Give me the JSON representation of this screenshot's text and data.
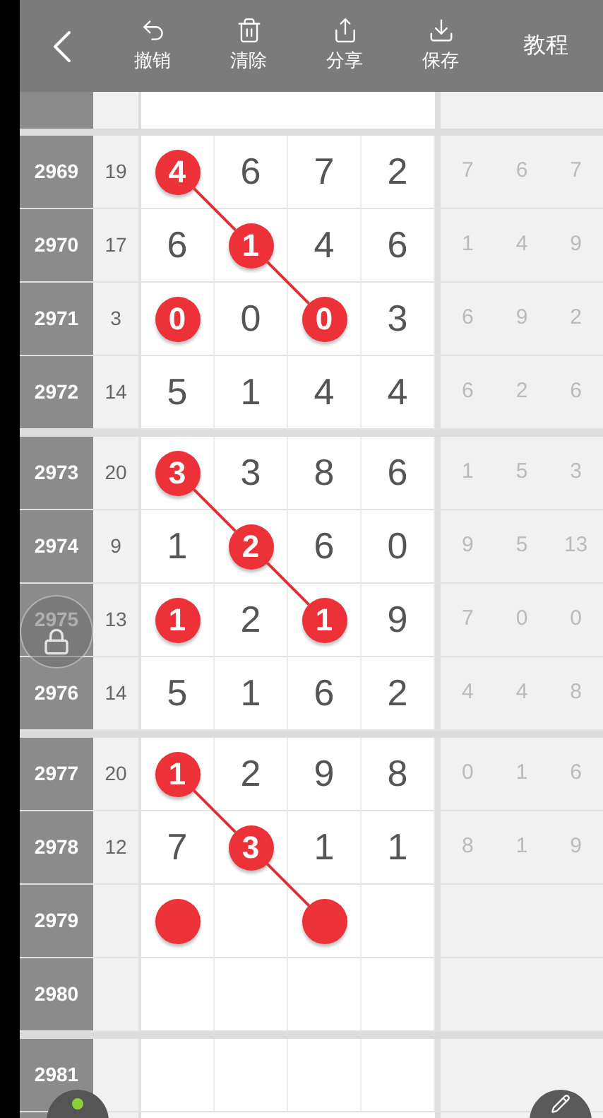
{
  "toolbar": {
    "actions": [
      {
        "kind": "undo",
        "label": "撤销"
      },
      {
        "kind": "clear",
        "label": "清除"
      },
      {
        "kind": "share",
        "label": "分享"
      },
      {
        "kind": "save",
        "label": "保存"
      }
    ],
    "tutorial": "教程"
  },
  "groups": [
    {
      "rows": [
        {
          "issue": "2969",
          "sum": "19",
          "cells": [
            {
              "value": "4",
              "marked": true,
              "on_line": true
            },
            {
              "value": "6",
              "marked": false
            },
            {
              "value": "7",
              "marked": false
            },
            {
              "value": "2",
              "marked": false
            }
          ],
          "extra": [
            "7",
            "6",
            "7"
          ]
        },
        {
          "issue": "2970",
          "sum": "17",
          "cells": [
            {
              "value": "6",
              "marked": false
            },
            {
              "value": "1",
              "marked": true,
              "on_line": true
            },
            {
              "value": "4",
              "marked": false
            },
            {
              "value": "6",
              "marked": false
            }
          ],
          "extra": [
            "1",
            "4",
            "9"
          ]
        },
        {
          "issue": "2971",
          "sum": "3",
          "cells": [
            {
              "value": "0",
              "marked": true,
              "on_line": false
            },
            {
              "value": "0",
              "marked": false
            },
            {
              "value": "0",
              "marked": true,
              "on_line": true
            },
            {
              "value": "3",
              "marked": false
            }
          ],
          "extra": [
            "6",
            "9",
            "2"
          ]
        },
        {
          "issue": "2972",
          "sum": "14",
          "cells": [
            {
              "value": "5",
              "marked": false
            },
            {
              "value": "1",
              "marked": false
            },
            {
              "value": "4",
              "marked": false
            },
            {
              "value": "4",
              "marked": false
            }
          ],
          "extra": [
            "6",
            "2",
            "6"
          ]
        }
      ]
    },
    {
      "rows": [
        {
          "issue": "2973",
          "sum": "20",
          "cells": [
            {
              "value": "3",
              "marked": true,
              "on_line": true
            },
            {
              "value": "3",
              "marked": false
            },
            {
              "value": "8",
              "marked": false
            },
            {
              "value": "6",
              "marked": false
            }
          ],
          "extra": [
            "1",
            "5",
            "3"
          ]
        },
        {
          "issue": "2974",
          "sum": "9",
          "cells": [
            {
              "value": "1",
              "marked": false
            },
            {
              "value": "2",
              "marked": true,
              "on_line": true
            },
            {
              "value": "6",
              "marked": false
            },
            {
              "value": "0",
              "marked": false
            }
          ],
          "extra": [
            "9",
            "5",
            "13"
          ]
        },
        {
          "issue": "2975",
          "sum": "13",
          "cells": [
            {
              "value": "1",
              "marked": true,
              "on_line": false
            },
            {
              "value": "2",
              "marked": false
            },
            {
              "value": "1",
              "marked": true,
              "on_line": true
            },
            {
              "value": "9",
              "marked": false
            }
          ],
          "extra": [
            "7",
            "0",
            "0"
          ]
        },
        {
          "issue": "2976",
          "sum": "14",
          "cells": [
            {
              "value": "5",
              "marked": false
            },
            {
              "value": "1",
              "marked": false
            },
            {
              "value": "6",
              "marked": false
            },
            {
              "value": "2",
              "marked": false
            }
          ],
          "extra": [
            "4",
            "4",
            "8"
          ]
        }
      ]
    },
    {
      "rows": [
        {
          "issue": "2977",
          "sum": "20",
          "cells": [
            {
              "value": "1",
              "marked": true,
              "on_line": true
            },
            {
              "value": "2",
              "marked": false
            },
            {
              "value": "9",
              "marked": false
            },
            {
              "value": "8",
              "marked": false
            }
          ],
          "extra": [
            "0",
            "1",
            "6"
          ]
        },
        {
          "issue": "2978",
          "sum": "12",
          "cells": [
            {
              "value": "7",
              "marked": false
            },
            {
              "value": "3",
              "marked": true,
              "on_line": true
            },
            {
              "value": "1",
              "marked": false
            },
            {
              "value": "1",
              "marked": false
            }
          ],
          "extra": [
            "8",
            "1",
            "9"
          ]
        },
        {
          "issue": "2979",
          "cells": [
            {
              "marked": true,
              "on_line": false
            },
            {
              "marked": false
            },
            {
              "marked": true,
              "on_line": true
            },
            {
              "marked": false
            }
          ]
        },
        {
          "issue": "2980"
        }
      ]
    },
    {
      "rows": [
        {
          "issue": "2981"
        }
      ]
    }
  ]
}
